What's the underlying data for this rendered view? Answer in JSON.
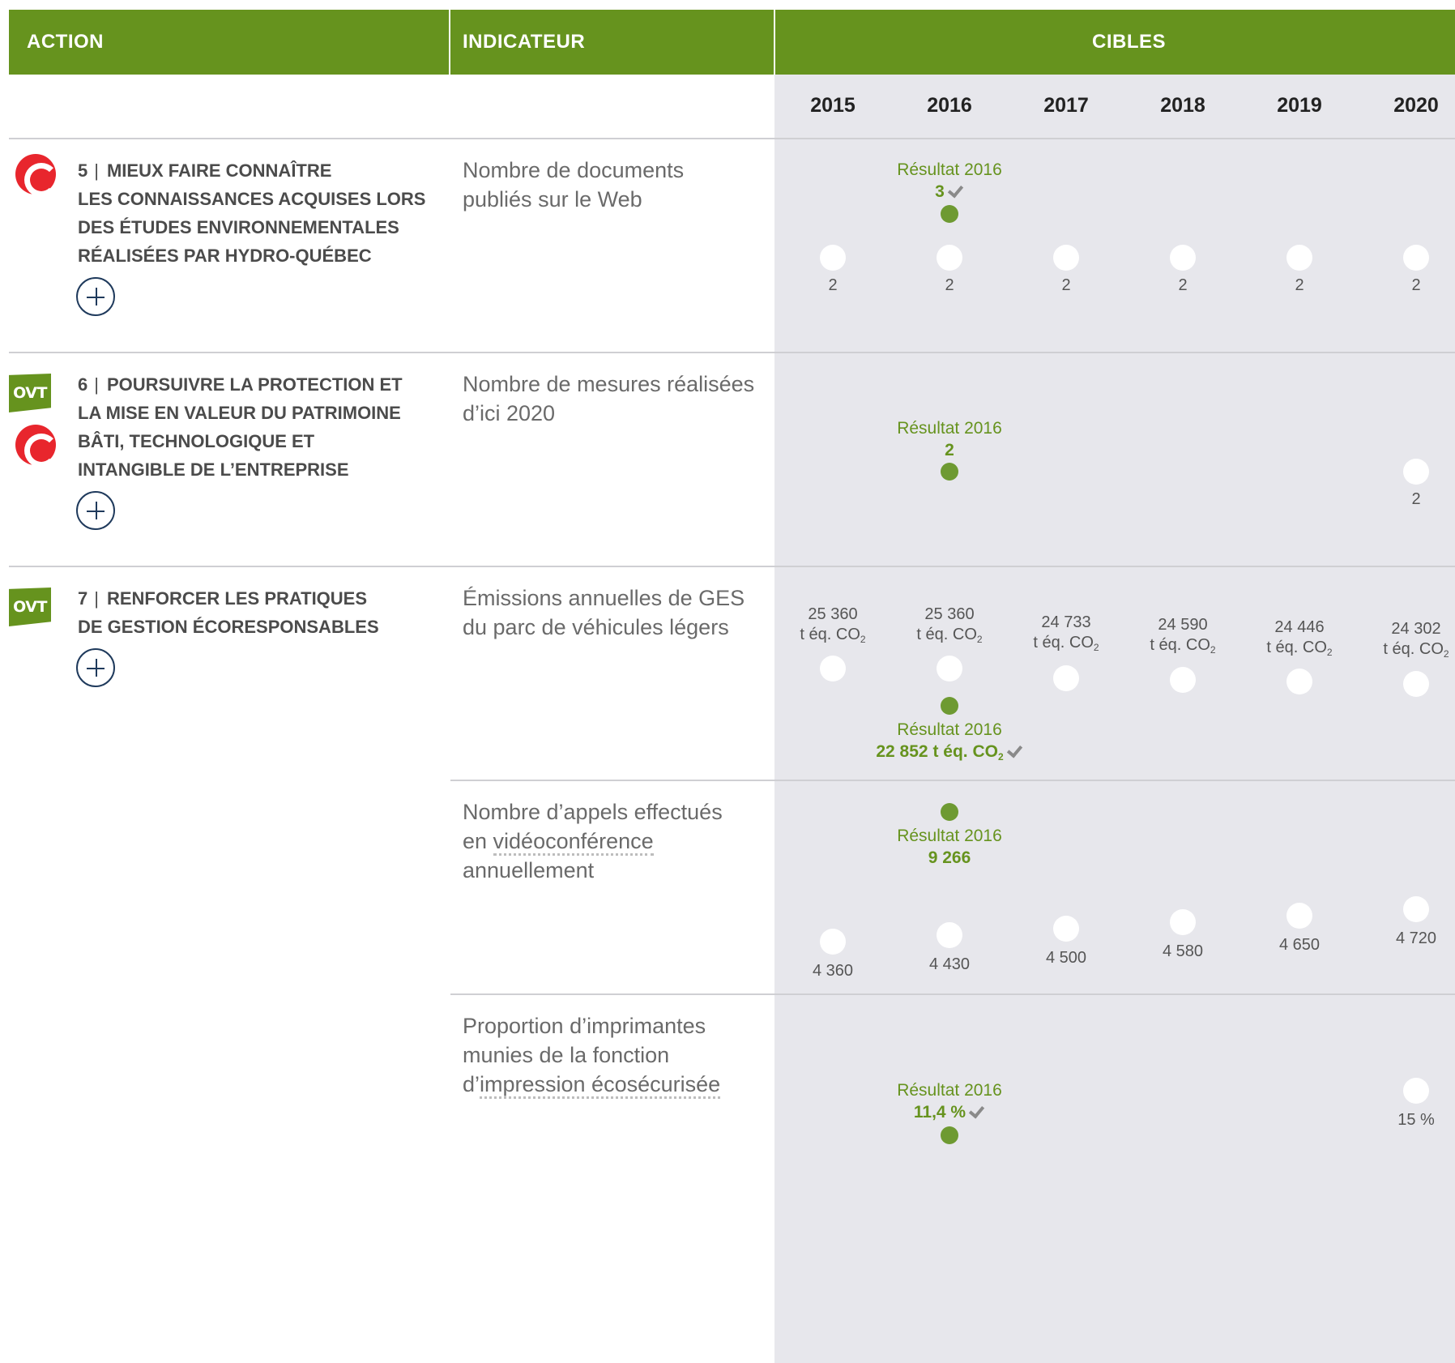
{
  "header": {
    "action": "ACTION",
    "indicateur": "INDICATEUR",
    "cibles": "CIBLES"
  },
  "years": [
    "2015",
    "2016",
    "2017",
    "2018",
    "2019",
    "2020"
  ],
  "badges": {
    "c": "C",
    "ovt": "OVT"
  },
  "result_label": "Résultat 2016",
  "co2_unit": "t éq. CO",
  "co2_sub": "2",
  "actions": [
    {
      "number": "5",
      "title": "MIEUX FAIRE CONNAÎTRE LES CONNAISSANCES ACQUISES LORS DES ÉTUDES ENVIRONNEMENTALES RÉALISÉES PAR HYDRO-QUÉBEC",
      "title_lines": [
        "MIEUX FAIRE CONNAÎTRE",
        "LES CONNAISSANCES ACQUISES LORS",
        "DES ÉTUDES ENVIRONNEMENTALES",
        "RÉALISÉES PAR HYDRO-QUÉBEC"
      ],
      "indicator_lines": [
        "Nombre de documents",
        "publiés sur le Web"
      ],
      "result": "3",
      "targets": [
        "2",
        "2",
        "2",
        "2",
        "2",
        "2"
      ]
    },
    {
      "number": "6",
      "title": "POURSUIVRE LA PROTECTION ET LA MISE EN VALEUR DU PATRIMOINE BÂTI, TECHNOLOGIQUE ET INTANGIBLE DE L'ENTREPRISE",
      "title_lines": [
        "POURSUIVRE LA PROTECTION ET",
        "LA MISE EN VALEUR DU PATRIMOINE",
        "BÂTI, TECHNOLOGIQUE ET",
        "INTANGIBLE DE L’ENTREPRISE"
      ],
      "indicator_lines": [
        "Nombre de mesures réalisées",
        "d’ici 2020"
      ],
      "result": "2",
      "target_2020": "2"
    },
    {
      "number": "7",
      "title_lines": [
        "RENFORCER LES PRATIQUES",
        "DE GESTION ÉCORESPONSABLES"
      ],
      "indicators": [
        {
          "lines": [
            "Émissions annuelles de GES",
            "du parc de véhicules légers"
          ],
          "result": "22 852",
          "targets": [
            "25 360",
            "25 360",
            "24 733",
            "24 590",
            "24 446",
            "24 302"
          ]
        },
        {
          "line1": "Nombre d’appels effectués",
          "line2_prefix": "en ",
          "line2_link": "vidéoconférence",
          "line3": "annuellement",
          "result": "9 266",
          "targets": [
            "4 360",
            "4 430",
            "4 500",
            "4 580",
            "4 650",
            "4 720"
          ]
        },
        {
          "line1": "Proportion d’imprimantes",
          "line2": "munies de la fonction",
          "line3_prefix": "d’",
          "line3_link": "impression écosécurisée",
          "result": "11,4 %",
          "target_2020": "15 %"
        }
      ]
    }
  ]
}
